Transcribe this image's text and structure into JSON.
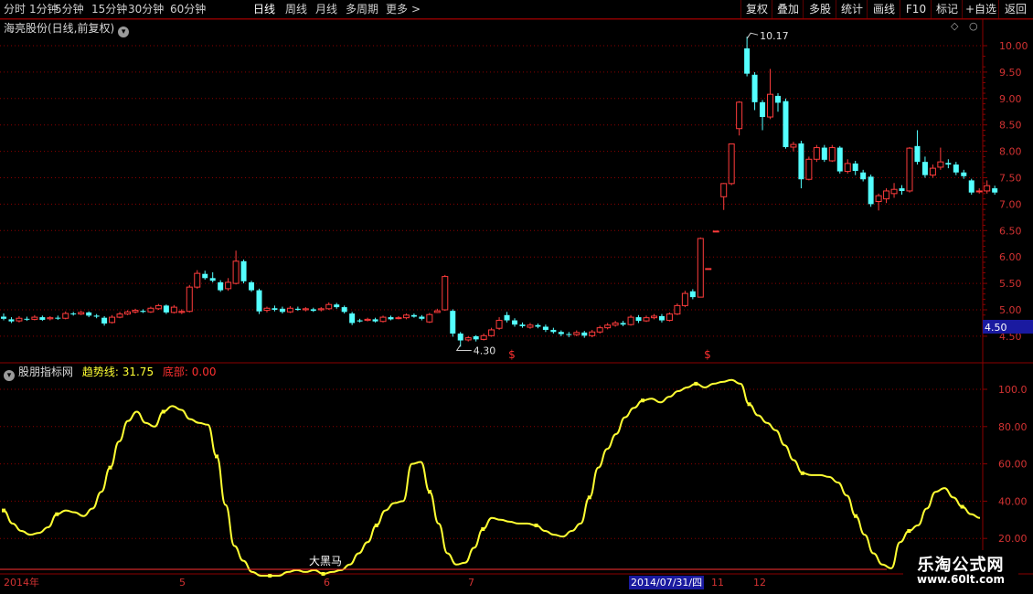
{
  "toolbar": {
    "periods": [
      {
        "label": "分时",
        "active": false
      },
      {
        "label": "1分钟",
        "active": false
      },
      {
        "label": "5分钟",
        "active": false
      },
      {
        "label": "15分钟",
        "active": false
      },
      {
        "label": "30分钟",
        "active": false
      },
      {
        "label": "60分钟",
        "active": false
      },
      {
        "label": "日线",
        "active": true
      },
      {
        "label": "周线",
        "active": false
      },
      {
        "label": "月线",
        "active": false
      },
      {
        "label": "多周期",
        "active": false
      },
      {
        "label": "更多",
        "active": false
      }
    ],
    "more_arrow": ">",
    "buttons": [
      "复权",
      "叠加",
      "多股",
      "统计",
      "画线",
      "F10",
      "标记",
      "+自选",
      "返回"
    ]
  },
  "main_panel": {
    "title": "海亮股份(日线,前复权)",
    "max_label": "10.17",
    "min_label": "4.30",
    "current_price": "4.50",
    "signal_marks": [
      "$",
      "$"
    ],
    "price_ticks": [
      "10.00",
      "9.50",
      "9.00",
      "8.50",
      "8.00",
      "7.50",
      "7.00",
      "6.50",
      "6.00",
      "5.50",
      "5.00",
      "4.50"
    ]
  },
  "indicator_panel": {
    "name": "股朋指标网",
    "trend_label": "趋势线:",
    "trend_value": "31.75",
    "bottom_label": "底部:",
    "bottom_value": "0.00",
    "annotation": "大黑马",
    "ticks": [
      "100.0",
      "80.00",
      "60.00",
      "40.00",
      "20.00"
    ]
  },
  "date_axis": {
    "labels": [
      "2014年",
      "5",
      "6",
      "7",
      "11",
      "12"
    ],
    "cursor_date": "2014/07/31/四"
  },
  "watermark": {
    "title": "乐淘公式网",
    "url": "www.60lt.com"
  },
  "colors": {
    "up": "#ff3c3c",
    "down": "#54ffff",
    "trend_line": "#ffff33",
    "grid": "#8b0000",
    "axis_text": "#d23232",
    "price_label_bg": "#1a1aa0"
  },
  "chart_data": {
    "type": "candlestick",
    "price_range": [
      4.3,
      10.17
    ],
    "ohlc": [
      [
        4.87,
        4.83,
        4.93,
        4.8
      ],
      [
        4.82,
        4.78,
        4.86,
        4.75
      ],
      [
        4.79,
        4.84,
        4.88,
        4.76
      ],
      [
        4.83,
        4.82,
        4.87,
        4.79
      ],
      [
        4.82,
        4.86,
        4.9,
        4.8
      ],
      [
        4.86,
        4.81,
        4.89,
        4.79
      ],
      [
        4.83,
        4.85,
        4.88,
        4.8
      ],
      [
        4.85,
        4.84,
        4.89,
        4.81
      ],
      [
        4.84,
        4.93,
        4.97,
        4.82
      ],
      [
        4.93,
        4.92,
        4.96,
        4.89
      ],
      [
        4.92,
        4.95,
        4.98,
        4.9
      ],
      [
        4.95,
        4.89,
        4.97,
        4.86
      ],
      [
        4.89,
        4.87,
        4.92,
        4.84
      ],
      [
        4.85,
        4.74,
        4.88,
        4.7
      ],
      [
        4.76,
        4.86,
        4.9,
        4.74
      ],
      [
        4.86,
        4.92,
        4.96,
        4.84
      ],
      [
        4.92,
        4.96,
        4.99,
        4.9
      ],
      [
        4.96,
        4.99,
        5.02,
        4.93
      ],
      [
        4.98,
        4.96,
        5.01,
        4.94
      ],
      [
        4.96,
        5.03,
        5.06,
        4.94
      ],
      [
        5.02,
        5.08,
        5.11,
        5.0
      ],
      [
        5.08,
        4.95,
        5.1,
        4.92
      ],
      [
        4.95,
        5.05,
        5.09,
        4.93
      ],
      [
        4.95,
        4.97,
        5.01,
        4.92
      ],
      [
        4.97,
        5.43,
        5.47,
        4.95
      ],
      [
        5.43,
        5.69,
        5.75,
        5.4
      ],
      [
        5.68,
        5.6,
        5.74,
        5.57
      ],
      [
        5.6,
        5.55,
        5.71,
        5.52
      ],
      [
        5.52,
        5.37,
        5.56,
        5.34
      ],
      [
        5.4,
        5.52,
        5.6,
        5.36
      ],
      [
        5.5,
        5.92,
        6.12,
        5.48
      ],
      [
        5.92,
        5.54,
        5.95,
        5.5
      ],
      [
        5.52,
        5.37,
        5.55,
        5.34
      ],
      [
        5.37,
        4.97,
        5.4,
        4.92
      ],
      [
        4.99,
        5.03,
        5.06,
        4.95
      ],
      [
        5.03,
        5.0,
        5.08,
        4.97
      ],
      [
        5.02,
        4.96,
        5.06,
        4.93
      ],
      [
        4.96,
        5.03,
        5.07,
        4.94
      ],
      [
        5.02,
        5.0,
        5.06,
        4.98
      ],
      [
        5.0,
        5.02,
        5.05,
        4.97
      ],
      [
        5.01,
        4.98,
        5.04,
        4.96
      ],
      [
        5.0,
        5.02,
        5.05,
        4.97
      ],
      [
        5.02,
        5.1,
        5.14,
        5.0
      ],
      [
        5.1,
        5.05,
        5.13,
        5.02
      ],
      [
        5.05,
        4.96,
        5.08,
        4.93
      ],
      [
        4.93,
        4.75,
        4.96,
        4.71
      ],
      [
        4.8,
        4.78,
        4.83,
        4.76
      ],
      [
        4.8,
        4.82,
        4.85,
        4.78
      ],
      [
        4.82,
        4.78,
        4.85,
        4.76
      ],
      [
        4.78,
        4.86,
        4.89,
        4.76
      ],
      [
        4.86,
        4.82,
        4.89,
        4.8
      ],
      [
        4.84,
        4.85,
        4.88,
        4.82
      ],
      [
        4.85,
        4.9,
        4.93,
        4.82
      ],
      [
        4.9,
        4.87,
        4.93,
        4.85
      ],
      [
        4.87,
        4.83,
        4.9,
        4.8
      ],
      [
        4.77,
        4.91,
        4.94,
        4.75
      ],
      [
        4.95,
        4.98,
        5.02,
        4.94
      ],
      [
        5.0,
        5.63,
        5.66,
        4.98
      ],
      [
        4.98,
        4.55,
        5.01,
        4.49
      ],
      [
        4.55,
        4.42,
        4.58,
        4.3
      ],
      [
        4.43,
        4.47,
        4.5,
        4.4
      ],
      [
        4.5,
        4.44,
        4.52,
        4.4
      ],
      [
        4.44,
        4.51,
        4.55,
        4.42
      ],
      [
        4.51,
        4.62,
        4.66,
        4.49
      ],
      [
        4.65,
        4.8,
        4.86,
        4.62
      ],
      [
        4.9,
        4.8,
        4.96,
        4.76
      ],
      [
        4.8,
        4.72,
        4.84,
        4.68
      ],
      [
        4.72,
        4.69,
        4.76,
        4.66
      ],
      [
        4.67,
        4.71,
        4.75,
        4.64
      ],
      [
        4.71,
        4.68,
        4.74,
        4.65
      ],
      [
        4.68,
        4.62,
        4.72,
        4.58
      ],
      [
        4.62,
        4.58,
        4.66,
        4.55
      ],
      [
        4.58,
        4.54,
        4.61,
        4.5
      ],
      [
        4.54,
        4.53,
        4.58,
        4.48
      ],
      [
        4.53,
        4.57,
        4.61,
        4.5
      ],
      [
        4.57,
        4.51,
        4.6,
        4.47
      ],
      [
        4.51,
        4.58,
        4.62,
        4.48
      ],
      [
        4.58,
        4.66,
        4.7,
        4.55
      ],
      [
        4.66,
        4.71,
        4.75,
        4.63
      ],
      [
        4.71,
        4.75,
        4.79,
        4.68
      ],
      [
        4.75,
        4.72,
        4.79,
        4.69
      ],
      [
        4.72,
        4.86,
        4.9,
        4.7
      ],
      [
        4.86,
        4.79,
        4.9,
        4.75
      ],
      [
        4.79,
        4.85,
        4.89,
        4.77
      ],
      [
        4.85,
        4.88,
        4.92,
        4.82
      ],
      [
        4.88,
        4.8,
        4.92,
        4.76
      ],
      [
        4.8,
        4.92,
        4.95,
        4.78
      ],
      [
        4.92,
        5.08,
        5.12,
        4.9
      ],
      [
        5.08,
        5.31,
        5.36,
        5.05
      ],
      [
        5.35,
        5.24,
        5.39,
        5.2
      ],
      [
        5.24,
        6.35,
        6.37,
        5.24
      ],
      [
        5.78,
        5.78,
        5.78,
        5.78
      ],
      [
        6.49,
        6.49,
        6.49,
        6.49
      ],
      [
        7.14,
        7.39,
        7.4,
        6.89
      ],
      [
        7.39,
        8.14,
        8.14,
        7.36
      ],
      [
        8.43,
        8.93,
        8.95,
        8.3
      ],
      [
        9.95,
        9.47,
        10.17,
        9.42
      ],
      [
        9.45,
        8.93,
        9.5,
        8.78
      ],
      [
        8.93,
        8.65,
        8.97,
        8.4
      ],
      [
        8.65,
        9.08,
        9.56,
        8.61
      ],
      [
        9.05,
        8.92,
        9.1,
        8.75
      ],
      [
        8.95,
        8.08,
        9.0,
        8.05
      ],
      [
        8.08,
        8.13,
        8.18,
        8.0
      ],
      [
        8.15,
        7.47,
        8.2,
        7.3
      ],
      [
        7.47,
        7.85,
        7.9,
        7.45
      ],
      [
        7.85,
        8.07,
        8.12,
        7.8
      ],
      [
        8.07,
        7.84,
        8.12,
        7.8
      ],
      [
        7.82,
        8.07,
        8.12,
        7.8
      ],
      [
        8.07,
        7.62,
        8.1,
        7.58
      ],
      [
        7.62,
        7.77,
        7.85,
        7.58
      ],
      [
        7.77,
        7.63,
        7.82,
        7.55
      ],
      [
        7.6,
        7.47,
        7.65,
        7.43
      ],
      [
        7.52,
        7.0,
        7.56,
        6.95
      ],
      [
        7.05,
        7.16,
        7.2,
        6.88
      ],
      [
        7.1,
        7.25,
        7.3,
        7.02
      ],
      [
        7.2,
        7.28,
        7.4,
        7.12
      ],
      [
        7.3,
        7.25,
        7.36,
        7.18
      ],
      [
        7.25,
        8.06,
        8.08,
        7.22
      ],
      [
        8.1,
        7.8,
        8.4,
        7.75
      ],
      [
        7.8,
        7.55,
        7.9,
        7.5
      ],
      [
        7.55,
        7.68,
        7.75,
        7.5
      ],
      [
        7.7,
        7.8,
        8.07,
        7.65
      ],
      [
        7.78,
        7.75,
        7.85,
        7.68
      ],
      [
        7.75,
        7.6,
        7.8,
        7.55
      ],
      [
        7.6,
        7.53,
        7.65,
        7.48
      ],
      [
        7.45,
        7.22,
        7.48,
        7.18
      ],
      [
        7.25,
        7.25,
        7.3,
        7.2
      ],
      [
        7.25,
        7.35,
        7.45,
        7.2
      ],
      [
        7.3,
        7.22,
        7.35,
        7.18
      ]
    ],
    "indicator_range": [
      0,
      108
    ],
    "indicator_values": [
      35,
      28,
      24,
      22,
      23,
      26,
      33,
      35,
      34,
      32,
      36,
      45,
      58,
      72,
      83,
      88,
      82,
      80,
      88,
      91,
      89,
      84,
      82,
      81,
      64,
      38,
      16,
      8,
      2,
      0,
      0,
      0,
      2,
      3,
      2,
      3,
      1,
      2,
      3,
      6,
      12,
      18,
      27,
      35,
      39,
      40,
      60,
      61,
      45,
      28,
      12,
      6,
      7,
      15,
      25,
      31,
      30,
      29,
      28,
      28,
      27,
      24,
      22,
      21,
      24,
      28,
      42,
      58,
      68,
      76,
      85,
      90,
      94,
      95,
      93,
      96,
      99,
      101,
      103,
      101,
      103,
      104,
      105,
      103,
      92,
      86,
      82,
      78,
      70,
      62,
      55,
      54,
      54,
      53,
      50,
      43,
      32,
      22,
      12,
      6,
      4,
      18,
      24,
      27,
      36,
      45,
      47,
      42,
      37,
      33,
      31
    ]
  }
}
